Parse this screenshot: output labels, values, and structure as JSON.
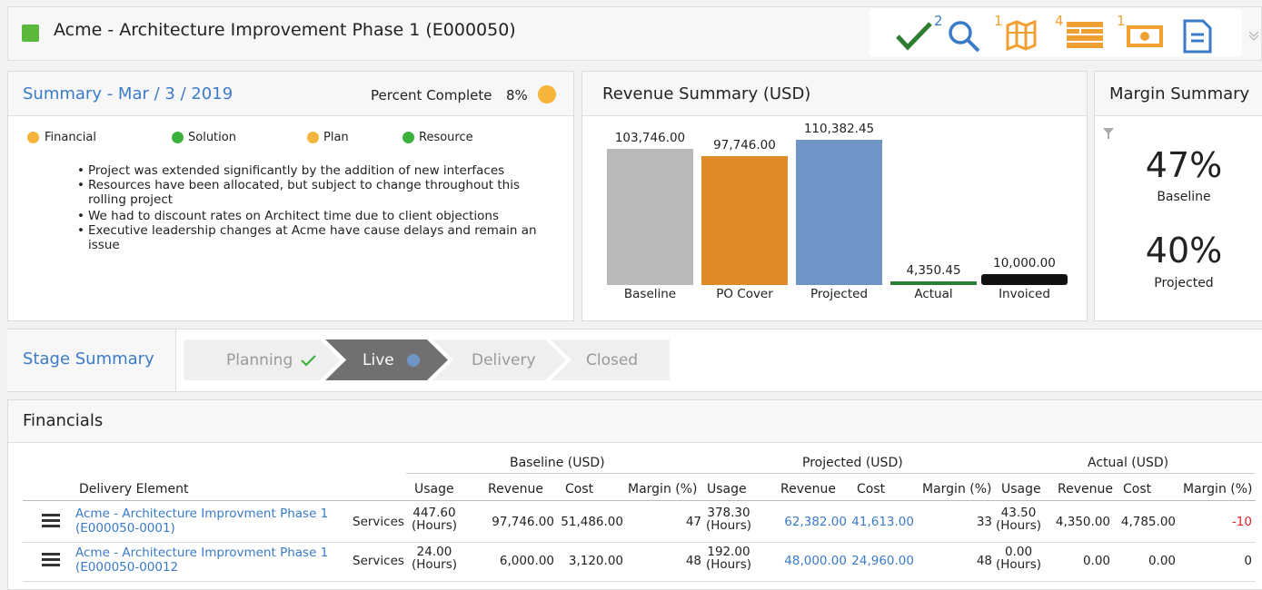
{
  "header": {
    "title": "Acme - Architecture Improvement Phase 1 (E000050)",
    "status_color": "#5cb83d",
    "toolbar": [
      {
        "icon": "checkmark-icon",
        "badge": "2",
        "color": "#2e7d32"
      },
      {
        "icon": "search-icon",
        "badge": "1",
        "color": "#3a7bc8"
      },
      {
        "icon": "map-icon",
        "badge": "4",
        "color": "#f0a030"
      },
      {
        "icon": "list-icon",
        "badge": "1",
        "color": "#f0a030"
      },
      {
        "icon": "money-icon",
        "badge": "",
        "color": "#f0a030"
      },
      {
        "icon": "document-icon",
        "badge": "",
        "color": "#3a7bc8"
      }
    ]
  },
  "summary": {
    "title": "Summary - Mar / 3 / 2019",
    "percent_label": "Percent Complete",
    "percent_value": "8%",
    "legend": [
      {
        "label": "Financial",
        "color": "#f5b53a"
      },
      {
        "label": "Solution",
        "color": "#3cb03c"
      },
      {
        "label": "Plan",
        "color": "#f5b53a"
      },
      {
        "label": "Resource",
        "color": "#3cb03c"
      }
    ],
    "bullets": [
      "Project was extended significantly by the addition of new interfaces",
      "Resources have been allocated, but subject to change throughout this rolling project",
      "We had to discount rates on Architect time due to client objections",
      "Executive leadership changes at Acme have cause delays and remain an issue"
    ]
  },
  "revenue": {
    "title": "Revenue Summary (USD)",
    "chart_data": {
      "type": "bar",
      "categories": [
        "Baseline",
        "PO Cover",
        "Projected",
        "Actual",
        "Invoiced"
      ],
      "values": [
        103746.0,
        97746.0,
        110382.45,
        4350.45,
        10000.0
      ],
      "labels": [
        "103,746.00",
        "97,746.00",
        "110,382.45",
        "4,350.45",
        "10,000.00"
      ],
      "colors": [
        "#b9b9b9",
        "#de8a27",
        "#6f95c6",
        "#2e7d32",
        "#111111"
      ]
    }
  },
  "margin": {
    "title": "Margin Summary",
    "baseline_value": "47%",
    "baseline_label": "Baseline",
    "projected_value": "40%",
    "projected_label": "Projected"
  },
  "stage": {
    "title": "Stage Summary",
    "stages": [
      "Planning",
      "Live",
      "Delivery",
      "Closed"
    ]
  },
  "financials": {
    "title": "Financials",
    "groups": [
      "Baseline (USD)",
      "Projected (USD)",
      "Actual (USD)"
    ],
    "columns": [
      "Delivery Element",
      "Usage",
      "Revenue",
      "Cost",
      "Margin (%)",
      "Usage",
      "Revenue",
      "Cost",
      "Margin (%)",
      "Usage",
      "Revenue",
      "Cost",
      "Margin (%)"
    ],
    "rows": [
      {
        "name1": "Acme - Architecture Improvment Phase 1",
        "name2": "(E000050-0001)",
        "type": "Services",
        "b_usage": "447.60",
        "b_unit": "(Hours)",
        "b_rev": "97,746.00",
        "b_cost": "51,486.00",
        "b_margin": "47",
        "p_usage": "378.30",
        "p_unit": "(Hours)",
        "p_rev": "62,382.00",
        "p_cost": "41,613.00",
        "p_margin": "33",
        "a_usage": "43.50",
        "a_unit": "(Hours)",
        "a_rev": "4,350.00",
        "a_cost": "4,785.00",
        "a_margin": "-10"
      },
      {
        "name1": "Acme - Architecture Improvment Phase 1",
        "name2": "(E000050-00012",
        "type": "Services",
        "b_usage": "24.00",
        "b_unit": "(Hours)",
        "b_rev": "6,000.00",
        "b_cost": "3,120.00",
        "b_margin": "48",
        "p_usage": "192.00",
        "p_unit": "(Hours)",
        "p_rev": "48,000.00",
        "p_cost": "24,960.00",
        "p_margin": "48",
        "a_usage": "0.00",
        "a_unit": "(Hours)",
        "a_rev": "0.00",
        "a_cost": "0.00",
        "a_margin": "0"
      }
    ]
  }
}
